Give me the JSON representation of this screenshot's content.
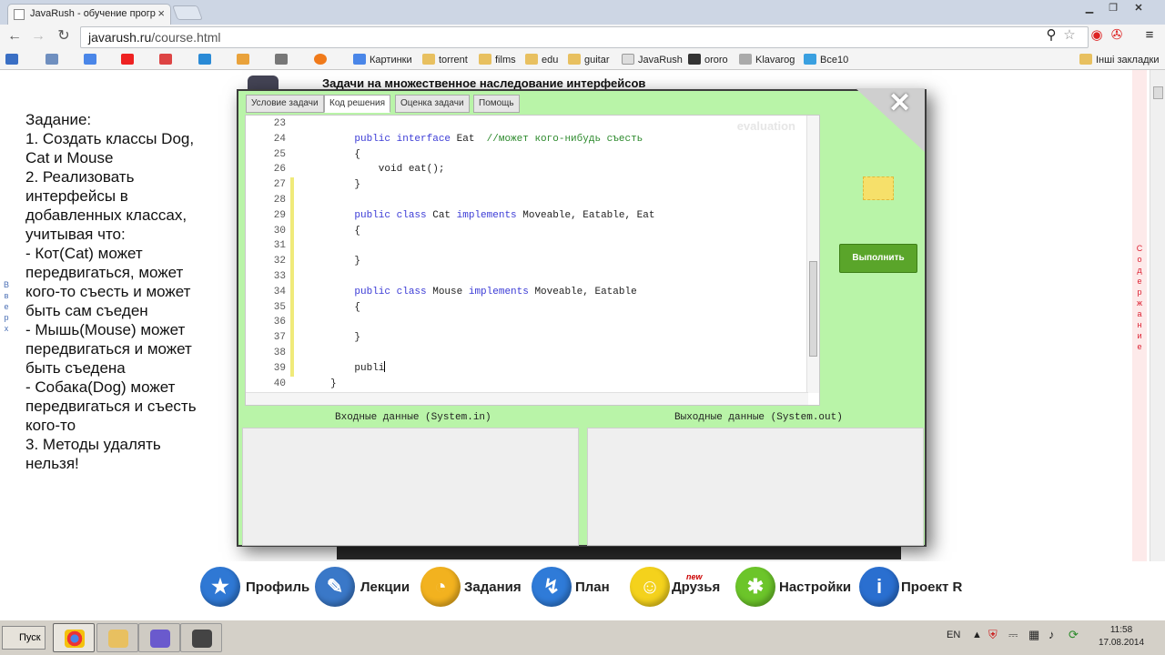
{
  "browser": {
    "tab_title": "JavaRush - обучение прогр",
    "address_host": "javarush.ru",
    "address_path": "/course.html",
    "bookmarks": [
      "Картинки",
      "torrent",
      "films",
      "edu",
      "guitar",
      "JavaRush",
      "ororo",
      "Klavarog",
      "Все10"
    ],
    "other_bookmarks": "Інші закладки"
  },
  "page": {
    "title": "Задачи на множественное наследование интерфейсов",
    "task_text": "Задание:\n1. Создать классы Dog, Cat и Mouse\n2. Реализовать интерфейсы в добавленных классах, учитывая что:\n- Кот(Cat) может передвигаться, может кого-то съесть и может быть сам съеден\n- Мышь(Mouse) может передвигаться и может быть съедена\n- Собака(Dog) может передвигаться и съесть кого-то\n3. Методы удалять нельзя!",
    "left_side_label": "Вверх",
    "right_side_label": "Содержание"
  },
  "modal": {
    "tabs": [
      "Условие задачи",
      "Код решения",
      "Оценка задачи",
      "Помощь"
    ],
    "active_tab": 1,
    "watermark": "evaluation",
    "run_button": "Выполнить",
    "input_label": "Входные данные (System.in)",
    "output_label": "Выходные данные (System.out)",
    "code_lines": [
      {
        "n": "23",
        "changed": false,
        "parts": []
      },
      {
        "n": "24",
        "changed": false,
        "parts": [
          [
            "",
            "    "
          ],
          [
            "kw",
            "public interface"
          ],
          [
            "",
            " Eat  "
          ],
          [
            "cm",
            "//может кого-нибудь съесть"
          ]
        ]
      },
      {
        "n": "25",
        "changed": false,
        "parts": [
          [
            "",
            "    {"
          ]
        ]
      },
      {
        "n": "26",
        "changed": false,
        "parts": [
          [
            "",
            "        void eat();"
          ]
        ]
      },
      {
        "n": "27",
        "changed": true,
        "parts": [
          [
            "",
            "    }"
          ]
        ]
      },
      {
        "n": "28",
        "changed": true,
        "parts": []
      },
      {
        "n": "29",
        "changed": true,
        "parts": [
          [
            "",
            "    "
          ],
          [
            "kw",
            "public class"
          ],
          [
            "",
            " Cat "
          ],
          [
            "kw",
            "implements"
          ],
          [
            "",
            " Moveable, Eatable, Eat"
          ]
        ]
      },
      {
        "n": "30",
        "changed": true,
        "parts": [
          [
            "",
            "    {"
          ]
        ]
      },
      {
        "n": "31",
        "changed": true,
        "parts": []
      },
      {
        "n": "32",
        "changed": true,
        "parts": [
          [
            "",
            "    }"
          ]
        ]
      },
      {
        "n": "33",
        "changed": true,
        "parts": []
      },
      {
        "n": "34",
        "changed": true,
        "parts": [
          [
            "",
            "    "
          ],
          [
            "kw",
            "public class"
          ],
          [
            "",
            " Mouse "
          ],
          [
            "kw",
            "implements"
          ],
          [
            "",
            " Moveable, Eatable"
          ]
        ]
      },
      {
        "n": "35",
        "changed": true,
        "parts": [
          [
            "",
            "    {"
          ]
        ]
      },
      {
        "n": "36",
        "changed": true,
        "parts": []
      },
      {
        "n": "37",
        "changed": true,
        "parts": [
          [
            "",
            "    }"
          ]
        ]
      },
      {
        "n": "38",
        "changed": true,
        "parts": []
      },
      {
        "n": "39",
        "changed": true,
        "parts": [
          [
            "",
            "    publi"
          ]
        ],
        "cursor": true
      },
      {
        "n": "40",
        "changed": false,
        "parts": [
          [
            "",
            "}"
          ]
        ]
      }
    ]
  },
  "nav": [
    {
      "label": "Профиль",
      "icon": "star-icon",
      "color": "#2f78d4",
      "sym": "★"
    },
    {
      "label": "Лекции",
      "icon": "scroll-icon",
      "color": "#3a78c8",
      "sym": "✎"
    },
    {
      "label": "Задания",
      "icon": "pacman-icon",
      "color": "#f2b21f",
      "sym": "◔"
    },
    {
      "label": "План",
      "icon": "route-icon",
      "color": "#2f7bd8",
      "sym": "↯"
    },
    {
      "label": "Друзья",
      "icon": "smile-icon",
      "color": "#f4d21c",
      "sym": "☺"
    },
    {
      "label": "Настройки",
      "icon": "gear-icon",
      "color": "#6cc52a",
      "sym": "✱"
    },
    {
      "label": "Проект R",
      "icon": "info-icon",
      "color": "#2a6fd0",
      "sym": "i"
    }
  ],
  "nav_new_badge": "new",
  "taskbar": {
    "start": "Пуск",
    "lang": "EN",
    "time": "11:58",
    "date": "17.08.2014"
  }
}
